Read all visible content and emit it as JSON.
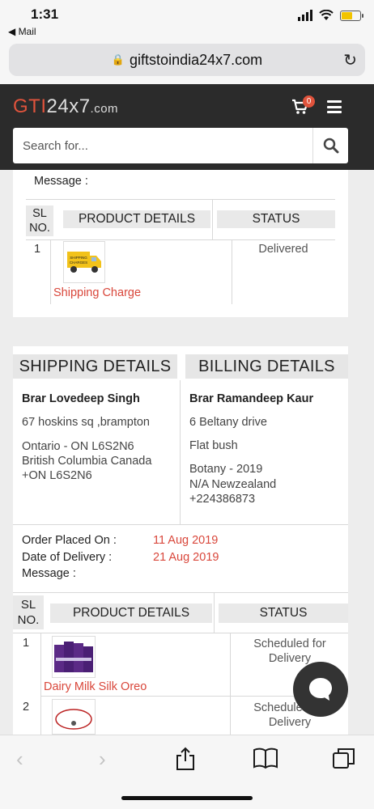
{
  "status_bar": {
    "time": "1:31",
    "back_app": "◀ Mail"
  },
  "browser": {
    "url": "giftstoindia24x7.com"
  },
  "header": {
    "logo_gti": "GTI",
    "logo_num": "24x7",
    "logo_tld": ".com",
    "cart_count": "0",
    "search_placeholder": "Search for..."
  },
  "order_top": {
    "message_label": "Message :",
    "headers": {
      "sl": "SL NO.",
      "product": "PRODUCT DETAILS",
      "status": "STATUS"
    },
    "rows": [
      {
        "sl": "1",
        "product": "Shipping Charge",
        "status": "Delivered",
        "image_icon": "truck-icon"
      }
    ]
  },
  "shipping": {
    "heading": "SHIPPING DETAILS",
    "name": "Brar Lovedeep Singh",
    "line1": "67 hoskins sq ,brampton",
    "line2": "Ontario - ON L6S2N6",
    "line3": "British Columbia Canada",
    "line4": "+ON L6S2N6"
  },
  "billing": {
    "heading": "BILLING DETAILS",
    "name": "Brar Ramandeep Kaur",
    "line1": "6 Beltany drive",
    "line2": "Flat bush",
    "line3": "Botany - 2019",
    "line4": "N/A Newzealand",
    "line5": "+224386873"
  },
  "order_info": {
    "placed_label": "Order Placed On :",
    "placed_value": "11 Aug 2019",
    "delivery_label": "Date of Delivery :",
    "delivery_value": "21 Aug 2019",
    "message_label": "Message :"
  },
  "order_main": {
    "headers": {
      "sl": "SL NO.",
      "product": "PRODUCT DETAILS",
      "status": "STATUS"
    },
    "rows": [
      {
        "sl": "1",
        "product": "Dairy Milk Silk Oreo",
        "status": "Scheduled for Delivery"
      },
      {
        "sl": "2",
        "product": "",
        "status": "Scheduled for Delivery"
      }
    ]
  },
  "colors": {
    "accent": "#d9473b",
    "header_bg": "#2b2b2b"
  }
}
